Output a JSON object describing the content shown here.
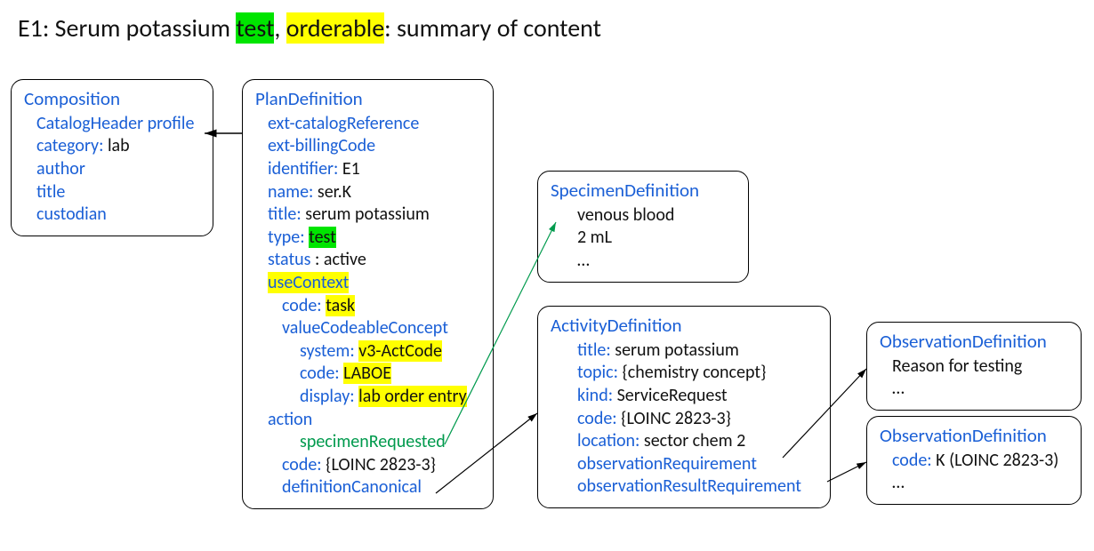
{
  "title": {
    "prefix": "E1: Serum potassium ",
    "hl1": "test",
    "mid": ", ",
    "hl2": "orderable",
    "suffix": ": summary of content"
  },
  "composition": {
    "heading": "Composition",
    "l1": "CatalogHeader profile",
    "l2k": "category: ",
    "l2v": "lab",
    "l3": "author",
    "l4": "title",
    "l5": "custodian"
  },
  "plan": {
    "heading": "PlanDefinition",
    "l1": "ext-catalogReference",
    "l2": "ext-billingCode",
    "l3k": "identifier: ",
    "l3v": "E1",
    "l4k": "name: ",
    "l4v": "ser.K",
    "l5k": "title: ",
    "l5v": "serum potassium",
    "l6k": "type: ",
    "l6v": "test",
    "l7k": "status ",
    "l7v": ": active",
    "l8": "useContext",
    "l9k": "code: ",
    "l9v": "task",
    "l10": "valueCodeableConcept",
    "l11k": "system: ",
    "l11v": "v3-ActCode",
    "l12k": "code: ",
    "l12v": "LABOE",
    "l13k": "display: ",
    "l13v": "lab order entry",
    "l14": "action",
    "l15": "specimenRequested",
    "l16k": "code: ",
    "l16v": "{LOINC 2823-3}",
    "l17": "definitionCanonical"
  },
  "specimen": {
    "heading": "SpecimenDefinition",
    "l1": "venous blood",
    "l2": "2 mL",
    "l3": "…"
  },
  "activity": {
    "heading": "ActivityDefinition",
    "l1k": "title: ",
    "l1v": "serum potassium",
    "l2k": "topic: ",
    "l2v": "{chemistry concept}",
    "l3k": "kind: ",
    "l3v": "ServiceRequest",
    "l4k": "code: ",
    "l4v": "{LOINC 2823-3}",
    "l5k": "location: ",
    "l5v": "sector chem 2",
    "l6": "observationRequirement",
    "l7": "observationResultRequirement"
  },
  "obs1": {
    "heading": "ObservationDefinition",
    "l1": "Reason for testing",
    "l2": "…"
  },
  "obs2": {
    "heading": "ObservationDefinition",
    "l1k": "code: ",
    "l1v": "K (LOINC 2823-3)",
    "l2": "…"
  }
}
